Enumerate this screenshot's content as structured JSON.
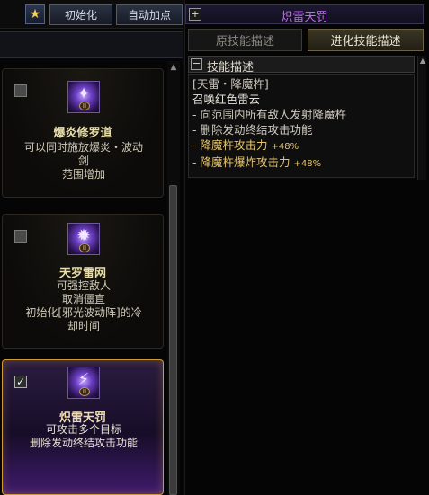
{
  "toolbar": {
    "reset_label": "初始化",
    "auto_label": "自动加点"
  },
  "skills": [
    {
      "title": "爆炎修罗道",
      "checked": false,
      "rank": "II",
      "desc": [
        "可以同时施放爆炎・波动",
        "剑",
        "范围增加"
      ]
    },
    {
      "title": "天罗雷网",
      "checked": false,
      "rank": "II",
      "desc": [
        "可强控敌人",
        "取消僵直",
        "初始化[邪光波动阵]的冷",
        "却时间"
      ]
    },
    {
      "title": "炽雷天罚",
      "checked": true,
      "rank": "II",
      "desc": [
        "可攻击多个目标",
        "删除发动终结攻击功能"
      ]
    }
  ],
  "detail": {
    "title": "炽雷天罚",
    "tabs": {
      "original": "原技能描述",
      "evolved": "进化技能描述"
    },
    "section_label": "技能描述",
    "lines": [
      "[天雷・降魔杵]",
      "召唤红色雷云",
      "- 向范围内所有敌人发射降魔杵",
      "- 删除发动终结攻击功能"
    ],
    "stat_lines": [
      {
        "label": "- 降魔杵攻击力 ",
        "value": "+48%"
      },
      {
        "label": "- 降魔杵爆炸攻击力 ",
        "value": "+48%"
      }
    ]
  },
  "colors": {
    "title_purple": "#c16cf0",
    "selected_border": "#cf9a33",
    "stat_gold": "#e4c36a"
  }
}
